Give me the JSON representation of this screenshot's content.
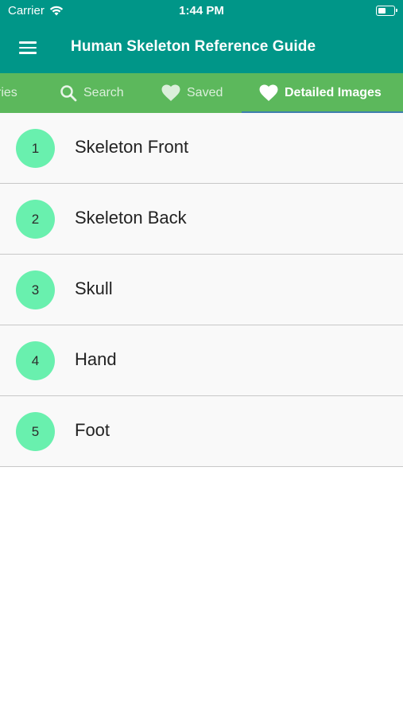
{
  "status_bar": {
    "carrier": "Carrier",
    "time": "1:44 PM",
    "battery_level": 0.4
  },
  "app_bar": {
    "title": "Human Skeleton Reference Guide"
  },
  "tabs": [
    {
      "label": "Categories",
      "visible_text": "ries",
      "icon": "list-icon"
    },
    {
      "label": "Search",
      "icon": "search-icon"
    },
    {
      "label": "Saved",
      "icon": "heart-icon"
    },
    {
      "label": "Detailed Images",
      "icon": "heart-icon",
      "active": true
    }
  ],
  "list": [
    {
      "number": "1",
      "label": "Skeleton Front"
    },
    {
      "number": "2",
      "label": "Skeleton Back"
    },
    {
      "number": "3",
      "label": "Skull"
    },
    {
      "number": "4",
      "label": "Hand"
    },
    {
      "number": "5",
      "label": "Foot"
    }
  ],
  "colors": {
    "primary": "#009688",
    "tabs": "#5cb85c",
    "badge": "#69f0ae",
    "indicator": "#3f7fae"
  }
}
